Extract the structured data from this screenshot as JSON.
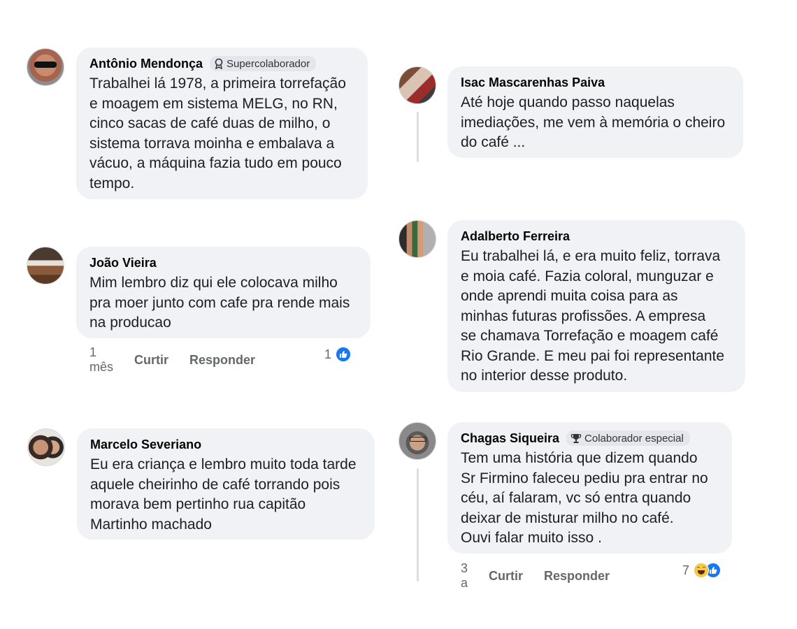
{
  "comments": [
    {
      "author": "Antônio Mendonça",
      "badge": "Supercolaborador",
      "badge_icon": "award-icon",
      "text": "Trabalhei lá 1978, a primeira torrefação\ne moagem em sistema MELG, no RN,\ncinco sacas de café duas de milho, o\nsistema torrava moinha e embalava a\nvácuo, a máquina fazia tudo em pouco\ntempo."
    },
    {
      "author": "Isac Mascarenhas Paiva",
      "text": "Até hoje quando passo naquelas\nimediações, me vem à memória o cheiro\ndo café ..."
    },
    {
      "author": "João Vieira",
      "text": "Mim lembro diz qui ele colocava milho\npra moer junto com cafe pra rende mais\nna producao",
      "time": "1 mês",
      "like_label": "Curtir",
      "reply_label": "Responder",
      "reaction_count": "1",
      "reactions": [
        "like-icon"
      ]
    },
    {
      "author": "Adalberto Ferreira",
      "text": "Eu trabalhei lá,  e era muito feliz,  torrava\ne moia café.  Fazia coloral,  munguzar e\nonde aprendi muita coisa para as\nminhas futuras profissões.  A empresa\nse chamava Torrefação e moagem café\nRio Grande. E meu pai foi representante\nno interior desse produto."
    },
    {
      "author": "Marcelo Severiano",
      "text": "Eu era criança e lembro muito toda tarde\naquele cheirinho de café torrando pois\nmorava bem pertinho rua capitão\nMartinho machado"
    },
    {
      "author": "Chagas Siqueira",
      "badge": "Colaborador especial",
      "badge_icon": "trophy-icon",
      "text": "Tem uma história  que dizem  quando\nSr Firmino  faleceu pediu pra entrar no\ncéu,  aí falaram,  vc só entra quando\ndeixar de misturar milho no café.\nOuvi falar muito isso .",
      "time": "3 a",
      "like_label": "Curtir",
      "reply_label": "Responder",
      "reaction_count": "7",
      "reactions": [
        "haha-icon",
        "like-icon"
      ]
    }
  ],
  "colors": {
    "bubble": "#f0f2f5",
    "meta_text": "#65676b",
    "like_blue": "#1877f2"
  }
}
